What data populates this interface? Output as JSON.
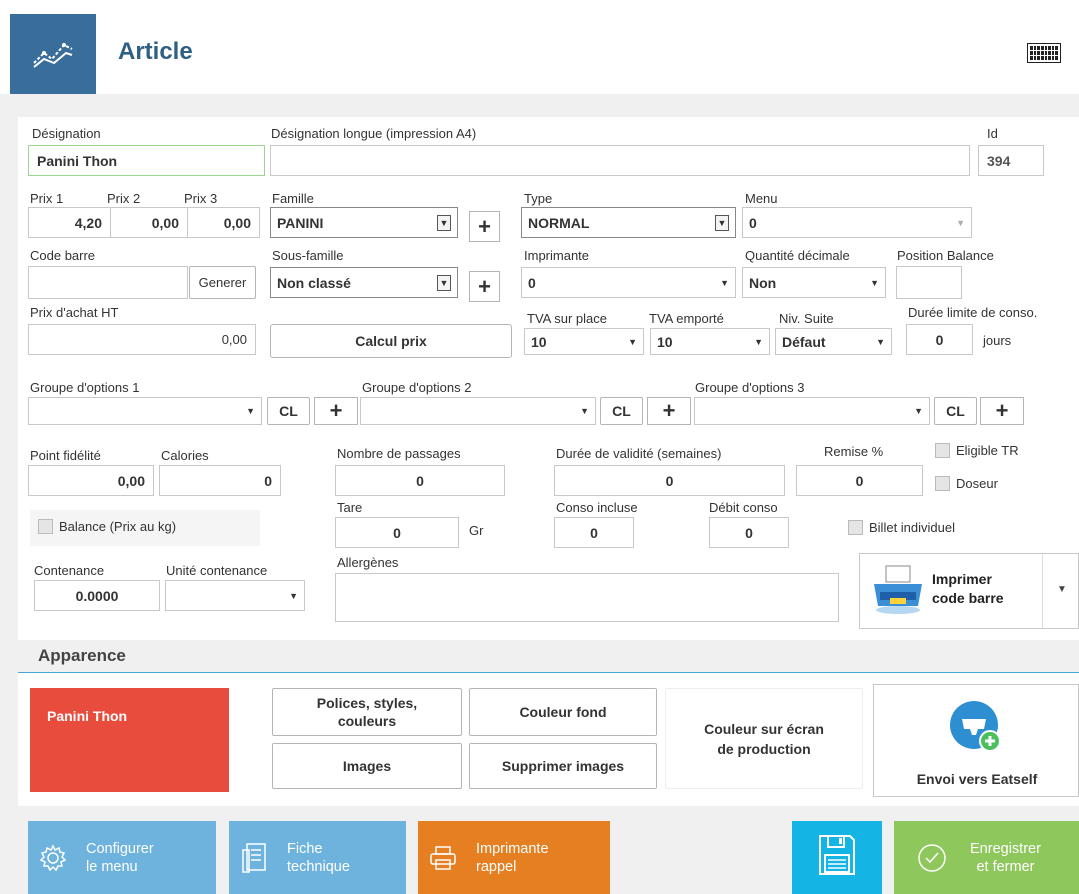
{
  "header": {
    "title": "Article",
    "logo_icon": "chart-line-icon",
    "keyboard_icon": "keyboard-icon"
  },
  "form": {
    "designation": {
      "label": "Désignation",
      "value": "Panini Thon"
    },
    "designation_longue": {
      "label": "Désignation longue (impression A4)",
      "value": ""
    },
    "id": {
      "label": "Id",
      "value": "394"
    },
    "prix1": {
      "label": "Prix 1",
      "value": "4,20"
    },
    "prix2": {
      "label": "Prix 2",
      "value": "0,00"
    },
    "prix3": {
      "label": "Prix 3",
      "value": "0,00"
    },
    "famille": {
      "label": "Famille",
      "value": "PANINI"
    },
    "type": {
      "label": "Type",
      "value": "NORMAL"
    },
    "menu": {
      "label": "Menu",
      "value": "0"
    },
    "code_barre": {
      "label": "Code barre",
      "value": "",
      "generate_label": "Generer"
    },
    "sous_famille": {
      "label": "Sous-famille",
      "value": "Non classé"
    },
    "imprimante": {
      "label": "Imprimante",
      "value": "0"
    },
    "quantite_decimale": {
      "label": "Quantité décimale",
      "value": "Non"
    },
    "position_balance": {
      "label": "Position Balance",
      "value": ""
    },
    "prix_achat": {
      "label": "Prix d'achat HT",
      "value": "0,00"
    },
    "calcul_prix": "Calcul prix",
    "tva_sur_place": {
      "label": "TVA sur place",
      "value": "10"
    },
    "tva_emporte": {
      "label": "TVA emporté",
      "value": "10"
    },
    "niv_suite": {
      "label": "Niv. Suite",
      "value": "Défaut"
    },
    "duree_limite": {
      "label": "Durée limite de conso.",
      "value": "0",
      "unit": "jours"
    },
    "groupe1": {
      "label": "Groupe d'options 1",
      "value": ""
    },
    "groupe2": {
      "label": "Groupe d'options 2",
      "value": ""
    },
    "groupe3": {
      "label": "Groupe d'options 3",
      "value": ""
    },
    "cl_label": "CL",
    "plus_label": "+",
    "point_fidelite": {
      "label": "Point fidélité",
      "value": "0,00"
    },
    "calories": {
      "label": "Calories",
      "value": "0"
    },
    "nombre_passages": {
      "label": "Nombre de passages",
      "value": "0"
    },
    "duree_validite": {
      "label": "Durée de validité (semaines)",
      "value": "0"
    },
    "remise": {
      "label": "Remise %",
      "value": "0"
    },
    "eligible_tr": "Eligible TR",
    "doseur": "Doseur",
    "balance": "Balance (Prix au kg)",
    "tare": {
      "label": "Tare",
      "value": "0",
      "unit": "Gr"
    },
    "conso_incluse": {
      "label": "Conso incluse",
      "value": "0"
    },
    "debit_conso": {
      "label": "Débit conso",
      "value": "0"
    },
    "billet_individuel": "Billet individuel",
    "contenance": {
      "label": "Contenance",
      "value": "0.0000"
    },
    "unite_contenance": {
      "label": "Unité contenance",
      "value": ""
    },
    "allergenes": {
      "label": "Allergènes",
      "value": ""
    },
    "imprimer_code_barre": {
      "line1": "Imprimer",
      "line2": "code barre"
    }
  },
  "apparence": {
    "title": "Apparence",
    "preview_text": "Panini Thon",
    "preview_color": "#e84c3d",
    "polices_line1": "Polices, styles,",
    "polices_line2": "couleurs",
    "couleur_fond": "Couleur fond",
    "couleur_ecran_line1": "Couleur sur écran",
    "couleur_ecran_line2": "de production",
    "images": "Images",
    "supprimer_images": "Supprimer images",
    "envoi_eatself": "Envoi vers Eatself"
  },
  "bottom": {
    "configurer": {
      "line1": "Configurer",
      "line2": "le menu",
      "color": "#6db3de"
    },
    "fiche": {
      "line1": "Fiche",
      "line2": "technique",
      "color": "#6db3de"
    },
    "imprimante_rappel": {
      "line1": "Imprimante",
      "line2": "rappel",
      "color": "#e67e22"
    },
    "save_color": "#14b4e4",
    "enregistrer": {
      "line1": "Enregistrer",
      "line2": "et fermer",
      "color": "#8ec75b"
    }
  }
}
